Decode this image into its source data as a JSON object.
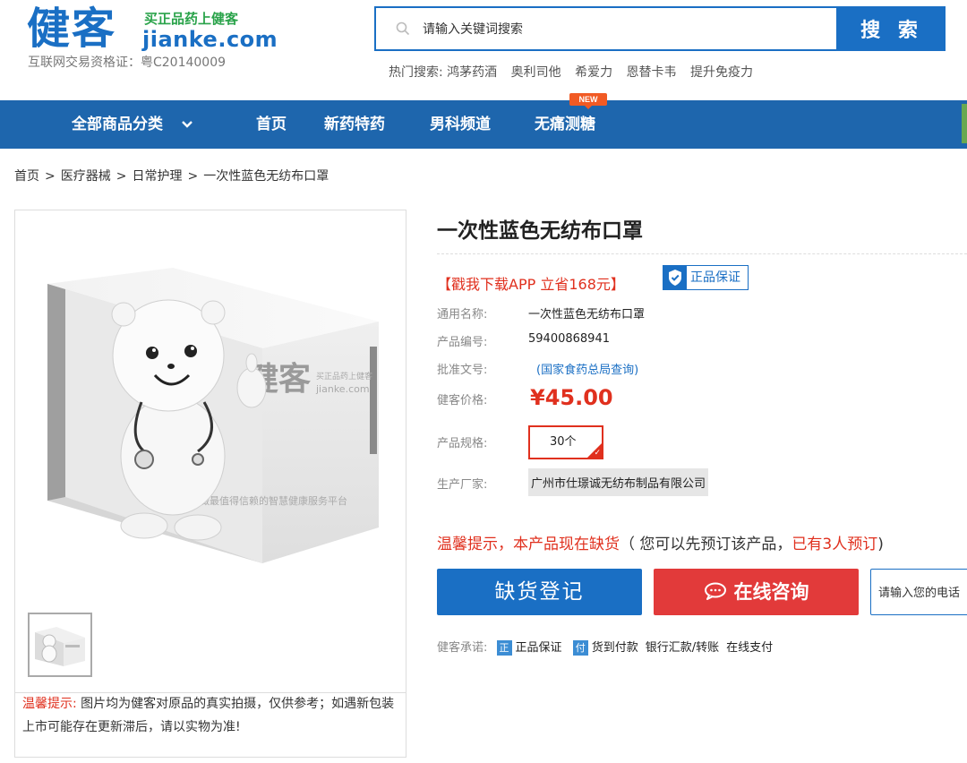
{
  "header": {
    "logo_text": "健客",
    "logo_slogan": "买正品药上健客",
    "logo_domain": "jianke.com",
    "license": "互联网交易资格证：粤C20140009",
    "search": {
      "placeholder": "请输入关键词搜索",
      "button": "搜 索"
    },
    "hot_search_label": "热门搜索:",
    "hot_search": [
      "鸿茅药酒",
      "奥利司他",
      "希爱力",
      "恩替卡韦",
      "提升免疫力"
    ]
  },
  "nav": {
    "all_categories": "全部商品分类",
    "items": [
      "首页",
      "新药特药",
      "男科频道",
      "无痛测糖"
    ],
    "new_badge": "NEW"
  },
  "breadcrumb": [
    "首页",
    "医疗器械",
    "日常护理",
    "一次性蓝色无纺布口罩"
  ],
  "breadcrumb_sep": ">",
  "gallery": {
    "box_brand": "健客",
    "box_slogan": "买正品药上健客",
    "box_domain": "jianke.com",
    "box_tagline": "做最值得信赖的智慧健康服务平台",
    "note_label": "温馨提示:",
    "note_text": "图片均为健客对原品的真实拍摄，仅供参考；如遇新包装上市可能存在更新滞后，请以实物为准!"
  },
  "product": {
    "title": "一次性蓝色无纺布口罩",
    "promo": "【戳我下载APP 立省168元】",
    "guarantee": "正品保证",
    "common_name_label": "通用名称:",
    "common_name": "一次性蓝色无纺布口罩",
    "code_label": "产品编号:",
    "code": "59400868941",
    "approval_label": "批准文号:",
    "approval": "(国家食药总局查询)",
    "price_label": "健客价格:",
    "price": "¥45.00",
    "spec_label": "产品规格:",
    "spec": "30个",
    "maker_label": "生产厂家:",
    "maker": "广州市仕璟诚无纺布制品有限公司"
  },
  "stock": {
    "tip_red": "温馨提示，本产品现在缺货",
    "tip_mid": "（ 您可以先预订该产品，",
    "tip_count": "已有3人预订",
    "tip_end": ")"
  },
  "actions": {
    "register": "缺货登记",
    "consult": "在线咨询",
    "phone_placeholder": "请输入您的电话"
  },
  "promise": {
    "label": "健客承诺:",
    "items": [
      {
        "tag": "正",
        "text": "正品保证"
      },
      {
        "tag": "付",
        "text": "货到付款"
      },
      {
        "tag": "",
        "text": "银行汇款/转账"
      },
      {
        "tag": "",
        "text": "在线支付"
      }
    ]
  },
  "colors": {
    "brand_blue": "#1a6fc4",
    "nav_blue": "#1e66ad",
    "accent_red": "#e0301e",
    "slogan_green": "#2aa34a"
  }
}
